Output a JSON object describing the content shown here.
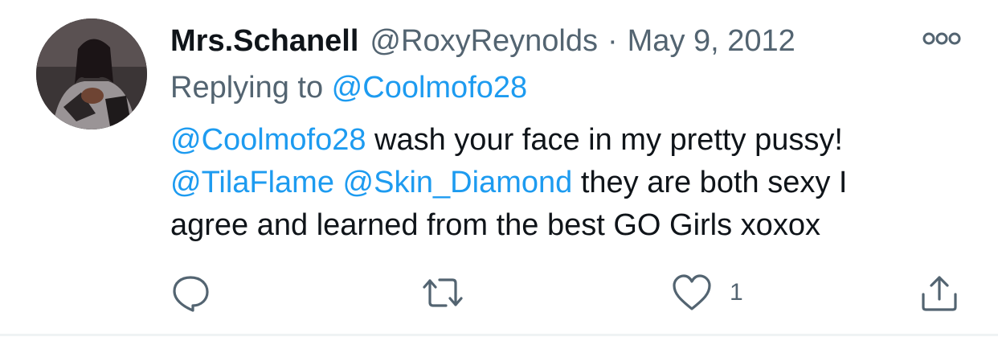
{
  "tweet": {
    "author_name": "Mrs.Schanell",
    "handle": "@RoxyReynolds",
    "separator": "·",
    "date": "May 9, 2012",
    "replying_prefix": "Replying to ",
    "replying_to": "@Coolmofo28",
    "body": {
      "line1_mention": "@Coolmofo28",
      "line1_text": " wash your face in my pretty pussy!",
      "line2_mention1": "@TilaFlame",
      "line2_space": " ",
      "line2_mention2": "@Skin_Diamond",
      "line2_text": " they are both sexy I",
      "line3_text": "agree and learned from the best GO Girls xoxox"
    },
    "like_count": "1"
  },
  "icons": {
    "more": "more-icon",
    "reply": "reply-icon",
    "retweet": "retweet-icon",
    "like": "heart-icon",
    "share": "share-icon"
  },
  "colors": {
    "link": "#1d9bf0",
    "secondary_text": "#536471",
    "primary_text": "#0f1419",
    "divider": "#eff3f4"
  }
}
